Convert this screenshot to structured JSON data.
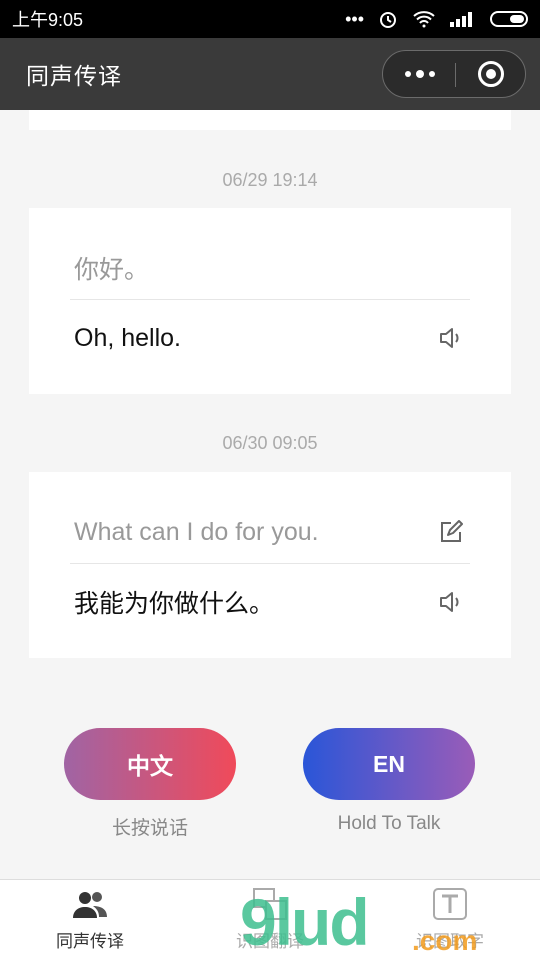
{
  "status_bar": {
    "time": "上午9:05"
  },
  "navbar": {
    "title": "同声传译"
  },
  "conversation": [
    {
      "timestamp": "06/29 19:14",
      "source": "你好。",
      "translation": "Oh, hello.",
      "editable": false
    },
    {
      "timestamp": "06/30 09:05",
      "source": "What can I do for you.",
      "translation": "我能为你做什么。",
      "editable": true
    }
  ],
  "talk_buttons": {
    "zh": {
      "label": "中文",
      "hint": "长按说话"
    },
    "en": {
      "label": "EN",
      "hint": "Hold To Talk"
    }
  },
  "tabbar": {
    "items": [
      {
        "label": "同声传译",
        "icon": "people-icon",
        "active": true
      },
      {
        "label": "识图翻译",
        "icon": "image-translate-icon",
        "active": false
      },
      {
        "label": "识图取字",
        "icon": "text-recognition-icon",
        "active": false
      }
    ]
  },
  "watermark": {
    "brand": "9lud",
    "suffix": ".com",
    "tagline": "小程序商店"
  },
  "colors": {
    "navbar": "#3a3a3a",
    "zh_gradient": [
      "#a064a4",
      "#f04a5a"
    ],
    "en_gradient": [
      "#2a56d8",
      "#9a5cb8"
    ]
  }
}
